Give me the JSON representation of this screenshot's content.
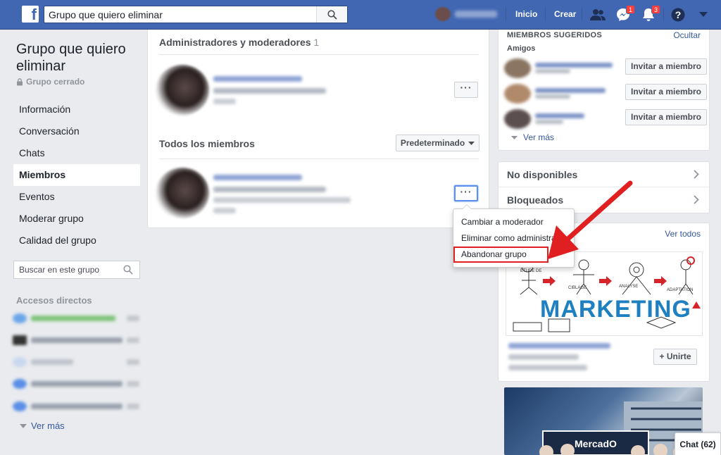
{
  "topbar": {
    "logo": "f",
    "search_value": "Grupo que quiero eliminar",
    "links": [
      "Inicio",
      "Crear"
    ],
    "messages_badge": "1",
    "notifications_badge": "3",
    "colors": {
      "bar": "#4267b2",
      "badge": "#fa3e3e"
    }
  },
  "group": {
    "title": "Grupo que quiero eliminar",
    "type": "Grupo cerrado"
  },
  "left_nav": {
    "items": [
      "Información",
      "Conversación",
      "Chats",
      "Miembros",
      "Eventos",
      "Moderar grupo",
      "Calidad del grupo"
    ],
    "active": "Miembros",
    "search_placeholder": "Buscar en este grupo",
    "shortcuts_title": "Accesos directos",
    "see_more": "Ver más"
  },
  "members": {
    "admins_title": "Administradores y moderadores",
    "admins_count": "1",
    "all_title": "Todos los miembros",
    "sort_label": "Predeterminado",
    "more_label": "···"
  },
  "dropdown": {
    "options": [
      "Cambiar a moderador",
      "Eliminar como administrador",
      "Abandonar grupo"
    ],
    "highlighted": "Abandonar grupo"
  },
  "right": {
    "suggested_title": "MIEMBROS SUGERIDOS",
    "hide_label": "Ocultar",
    "friends_label": "Amigos",
    "invite_label": "Invitar a miembro",
    "see_more": "Ver más",
    "unavailable": "No disponibles",
    "blocked": "Bloqueados",
    "see_all": "Ver todos",
    "join_label": "+ Unirte",
    "marketing_word": "MARKETING"
  },
  "chat": {
    "label": "Chat (62)"
  },
  "annotation": {
    "color": "#e02020"
  }
}
